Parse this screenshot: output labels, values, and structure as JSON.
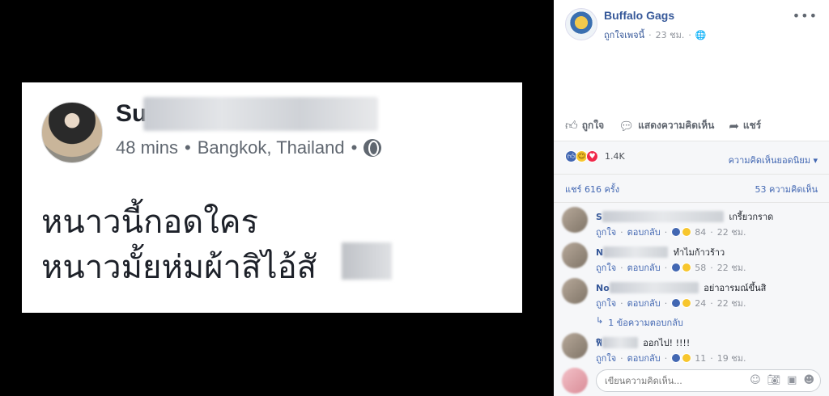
{
  "photo": {
    "name_visible": "Su",
    "meta_time": "48 mins",
    "meta_location": "Bangkok, Thailand",
    "line1": "หนาวนี้กอดใคร",
    "line2": "หนาวมั้ยห่มผ้าสิไอ้สั"
  },
  "post": {
    "page_name": "Buffalo Gags",
    "like_page": "ถูกใจเพจนี้",
    "time": "23 ชม.",
    "more_icon": "more-icon"
  },
  "actions": {
    "like": "ถูกใจ",
    "comment": "แสดงความคิดเห็น",
    "share": "แชร์"
  },
  "reactions": {
    "count": "1.4K",
    "sort_label": "ความคิดเห็นยอดนิยม ▾"
  },
  "stats": {
    "shares": "แชร์ 616 ครั้ง",
    "comments": "53 ความคิดเห็น"
  },
  "comments": [
    {
      "author": "S",
      "text": "เกรี้ยวกราด",
      "like": "ถูกใจ",
      "reply": "ตอบกลับ",
      "reactions": "84",
      "time": "22 ชม."
    },
    {
      "author": "N",
      "text": "ทำไมก้าวร้าว",
      "like": "ถูกใจ",
      "reply": "ตอบกลับ",
      "reactions": "58",
      "time": "22 ชม."
    },
    {
      "author": "No",
      "text": "อย่าอารมณ์ขึ้นสิ",
      "like": "ถูกใจ",
      "reply": "ตอบกลับ",
      "reactions": "24",
      "time": "22 ชม."
    },
    {
      "author": "ฟิ",
      "text": "ออกไป! !!!!",
      "like": "ถูกใจ",
      "reply": "ตอบกลับ",
      "reactions": "11",
      "time": "19 ชม."
    }
  ],
  "replies_link": "1 ข้อความตอบกลับ",
  "composer": {
    "placeholder": "เขียนความคิดเห็น..."
  },
  "colors": {
    "link": "#365899",
    "accent": "#4267b2",
    "muted": "#90949c"
  }
}
